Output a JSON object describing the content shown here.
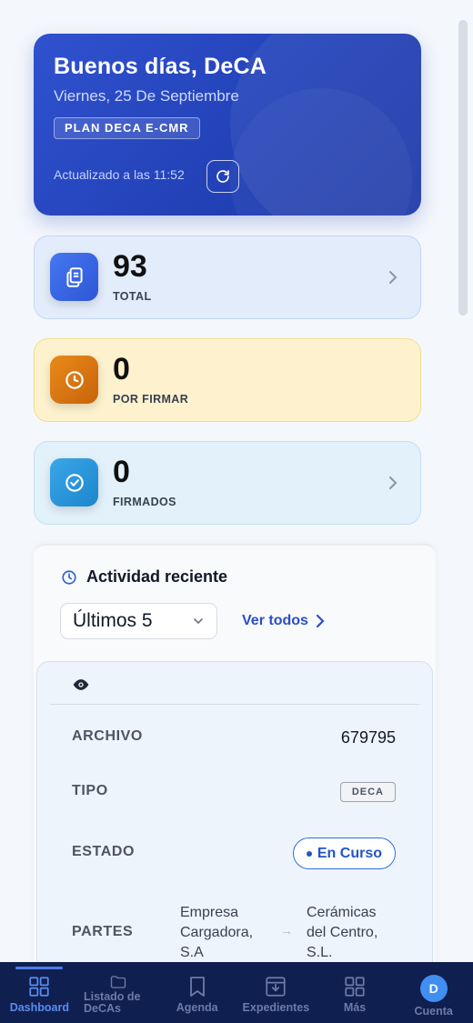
{
  "greeting": {
    "title": "Buenos días, DeCA",
    "date": "Viernes, 25 De Septiembre",
    "plan": "PLAN DECA E-CMR",
    "updated": "Actualizado a las 11:52"
  },
  "stats": [
    {
      "value": "93",
      "label": "TOTAL",
      "icon": "documents-icon",
      "color": "#2d56d6"
    },
    {
      "value": "0",
      "label": "POR FIRMAR",
      "icon": "clock-icon",
      "color": "#c7640a"
    },
    {
      "value": "0",
      "label": "FIRMADOS",
      "icon": "check-circle-icon",
      "color": "#1c86cc"
    }
  ],
  "activity": {
    "title": "Actividad reciente",
    "filter_selected": "Últimos 5",
    "view_all": "Ver todos",
    "record": {
      "archivo_label": "ARCHIVO",
      "archivo_value": "679795",
      "tipo_label": "TIPO",
      "tipo_value": "DECA",
      "estado_label": "ESTADO",
      "estado_value": "En Curso",
      "partes_label": "PARTES",
      "from": "Empresa Cargadora, S.A",
      "to": "Cerámicas del Centro, S.L."
    }
  },
  "nav": {
    "dashboard": "Dashboard",
    "listado": "Listado de DeCAs",
    "agenda": "Agenda",
    "expedientes": "Expedientes",
    "mas": "Más",
    "cuenta": "Cuenta",
    "avatar_initial": "D"
  }
}
